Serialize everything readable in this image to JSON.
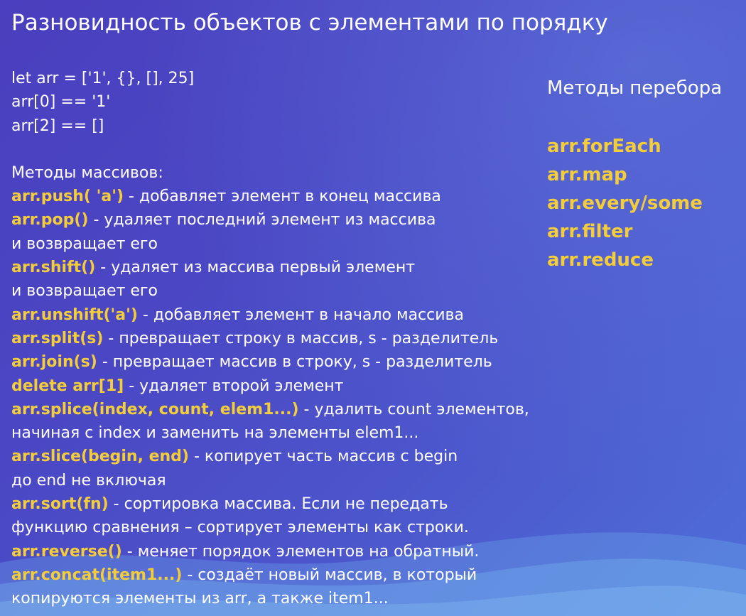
{
  "title": "Разновидность объектов с элементами по порядку",
  "examples": [
    "let arr = ['1', {}, [], 25]",
    "arr[0] == '1'",
    "arr[2] == []"
  ],
  "methods_heading": "Методы массивов:",
  "methods": [
    {
      "code": "arr.push( 'a')",
      "desc": " - добавляет элемент в конец массива"
    },
    {
      "code": "arr.pop()",
      "desc": " - удаляет последний элемент из массива"
    },
    {
      "code": "",
      "desc": "и возвращает его"
    },
    {
      "code": "arr.shift()",
      "desc": " - удаляет из массива первый элемент"
    },
    {
      "code": "",
      "desc": "и возвращает его"
    },
    {
      "code": "arr.unshift('a')",
      "desc": " - добавляет элемент в начало массива"
    },
    {
      "code": "arr.split(s)",
      "desc": " - превращает строку в массив, s - разделитель"
    },
    {
      "code": "arr.join(s)",
      "desc": " - превращает массив в строку, s - разделитель"
    },
    {
      "code": "delete arr[1]",
      "desc": " - удаляет второй элемент"
    },
    {
      "code": "arr.splice(index, count, elem1...)",
      "desc": " - удалить count элементов,"
    },
    {
      "code": "",
      "desc": "начиная с index и заменить на элементы elem1..."
    },
    {
      "code": "arr.slice(begin, end)",
      "desc": " - копирует часть массив с begin"
    },
    {
      "code": "",
      "desc": "до end не включая"
    },
    {
      "code": "arr.sort(fn)",
      "desc": " - сортировка массива. Если не передать"
    },
    {
      "code": "",
      "desc": "функцию сравнения – сортирует элементы как строки."
    },
    {
      "code": "arr.reverse()",
      "desc": " - меняет порядок элементов на обратный."
    },
    {
      "code": "arr.concat(item1...)",
      "desc": " - создаёт новый массив, в который"
    },
    {
      "code": "",
      "desc": "копируются элементы из arr, а также item1..."
    }
  ],
  "iteration_heading": "Методы перебора",
  "iteration_methods": [
    "arr.forEach",
    "arr.map",
    "arr.every/some",
    "arr.filter",
    "arr.reduce"
  ],
  "colors": {
    "accent": "#f4cd3a",
    "text": "#ffffff",
    "background_start": "#4a3fbe",
    "background_end": "#4f6fd8"
  }
}
